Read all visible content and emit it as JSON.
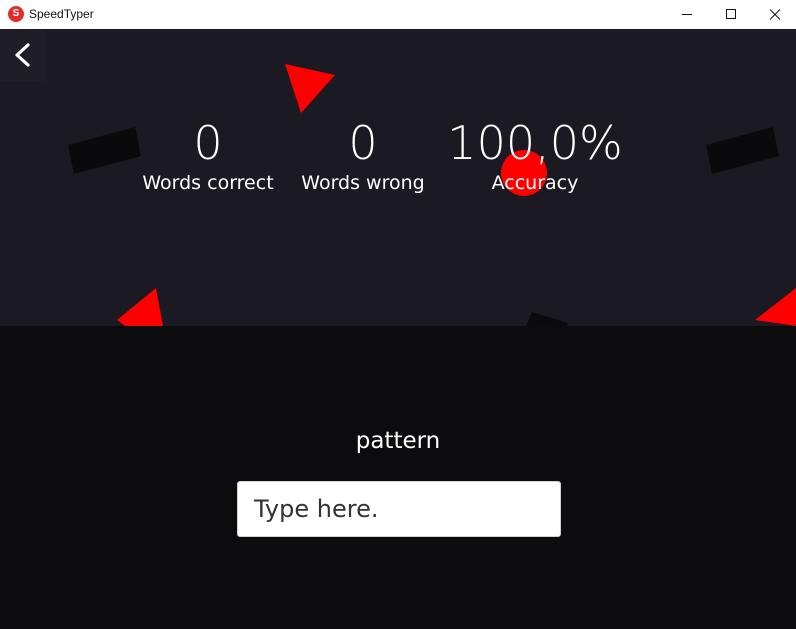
{
  "window": {
    "title": "SpeedTyper",
    "icon_letter": "S"
  },
  "stats": {
    "correct": {
      "value": "0",
      "label": "Words correct"
    },
    "wrong": {
      "value": "0",
      "label": "Words wrong"
    },
    "accuracy": {
      "value": "100,0%",
      "label": "Accuracy"
    }
  },
  "game": {
    "current_word": "pattern",
    "input_value": "",
    "input_placeholder": "Type here."
  },
  "colors": {
    "accent": "#ff0000",
    "stats_background": "#1b1a22",
    "lower_background": "#0c0c0e",
    "dark_shape": "#0a0a0c"
  },
  "icons": [
    "app-icon",
    "minimize-icon",
    "maximize-icon",
    "close-icon",
    "back-arrow-icon"
  ]
}
